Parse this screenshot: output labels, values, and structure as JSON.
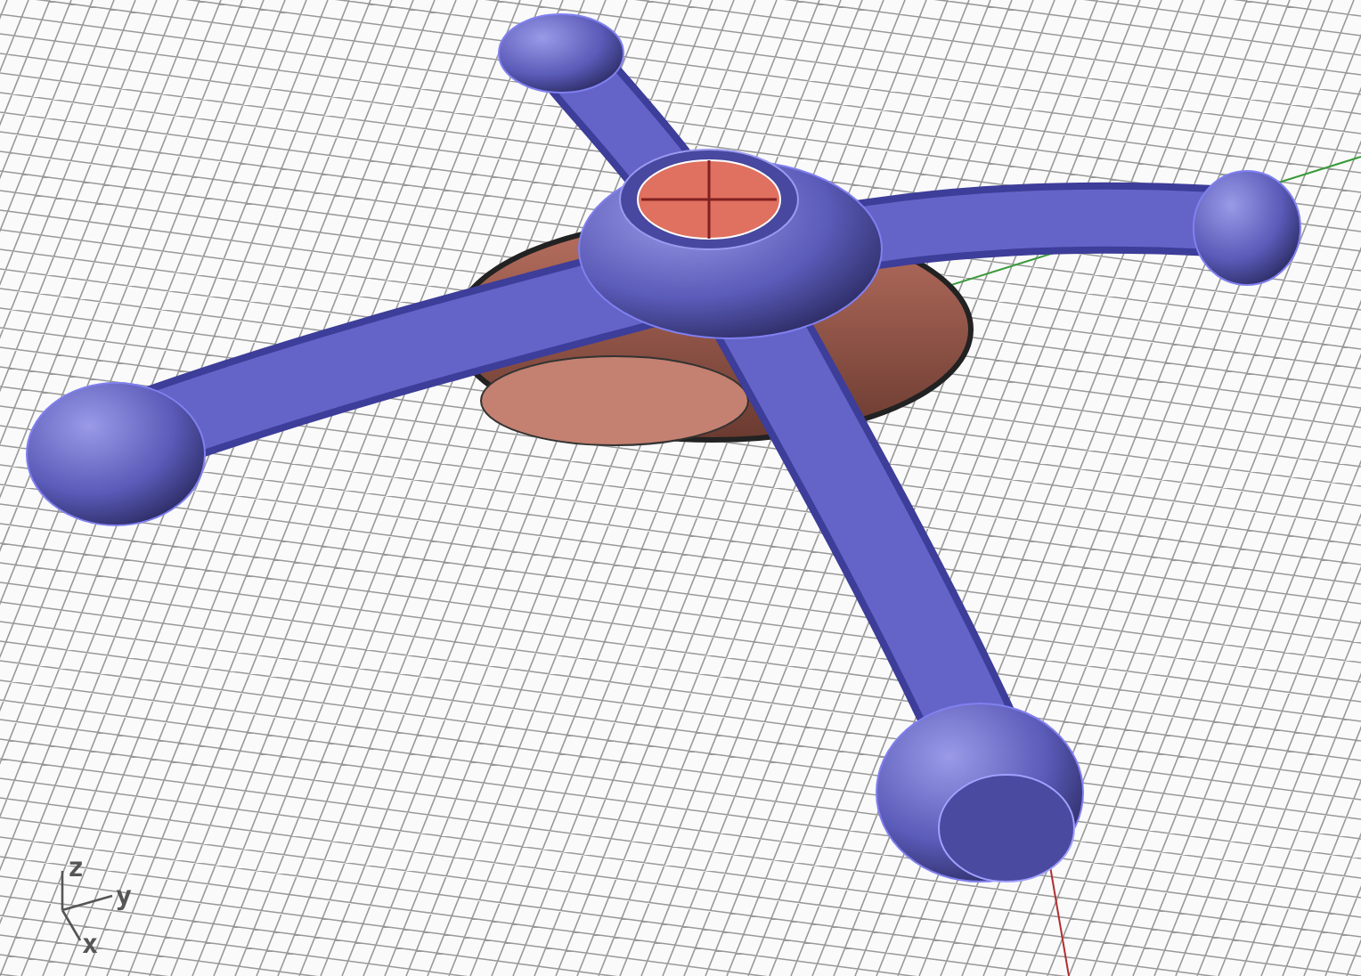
{
  "viewport": {
    "axes": [
      {
        "label": "z"
      },
      {
        "label": "y"
      },
      {
        "label": "x"
      }
    ]
  }
}
